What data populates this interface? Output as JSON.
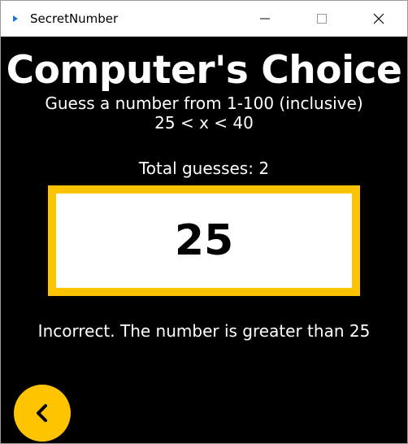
{
  "window": {
    "title": "SecretNumber"
  },
  "main": {
    "heading": "Computer's Choice",
    "instructions": "Guess a number from 1-100 (inclusive)",
    "range": "25 < x < 40",
    "total_guesses": "Total guesses: 2",
    "guess_value": "25",
    "feedback": "Incorrect. The number is greater than 25"
  },
  "colors": {
    "accent": "#ffc400",
    "background": "#000000",
    "text": "#ffffff"
  },
  "icons": {
    "back": "chevron-left-icon"
  }
}
